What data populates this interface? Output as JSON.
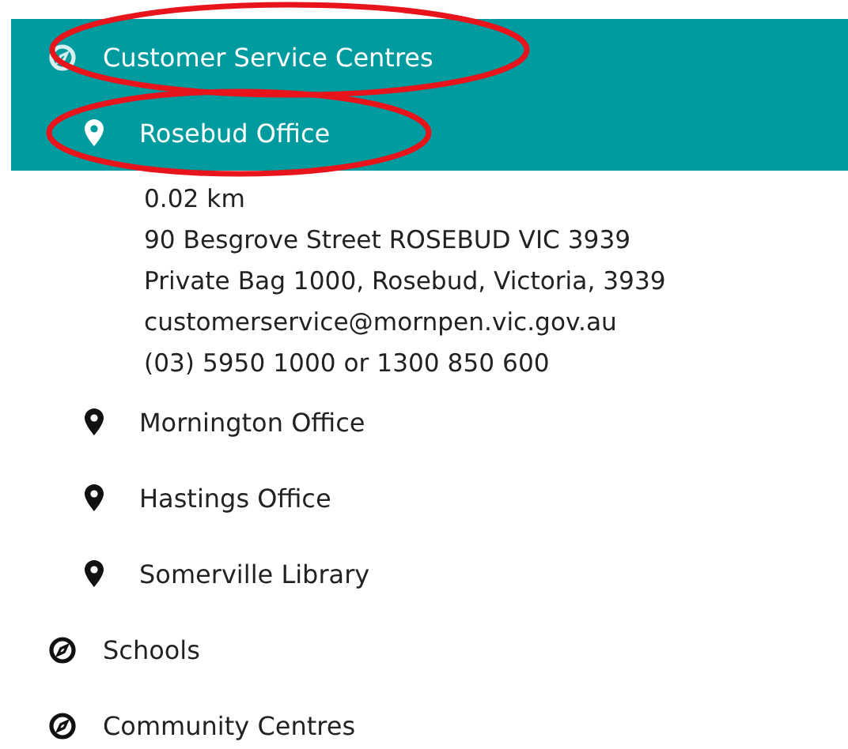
{
  "categories": [
    {
      "label": "Customer Service Centres",
      "expanded": true,
      "circled": true,
      "items": [
        {
          "label": "Rosebud Office",
          "selected": true,
          "circled": true,
          "details": [
            "0.02 km",
            "90 Besgrove Street ROSEBUD VIC 3939",
            "Private Bag 1000, Rosebud, Victoria, 3939",
            "customerservice@mornpen.vic.gov.au",
            "(03) 5950 1000 or 1300 850 600"
          ]
        },
        {
          "label": "Mornington Office",
          "selected": false,
          "circled": false
        },
        {
          "label": "Hastings Office",
          "selected": false,
          "circled": false
        },
        {
          "label": "Somerville Library",
          "selected": false,
          "circled": false
        }
      ]
    },
    {
      "label": "Schools",
      "expanded": false,
      "circled": false
    },
    {
      "label": "Community Centres",
      "expanded": false,
      "circled": false
    }
  ]
}
